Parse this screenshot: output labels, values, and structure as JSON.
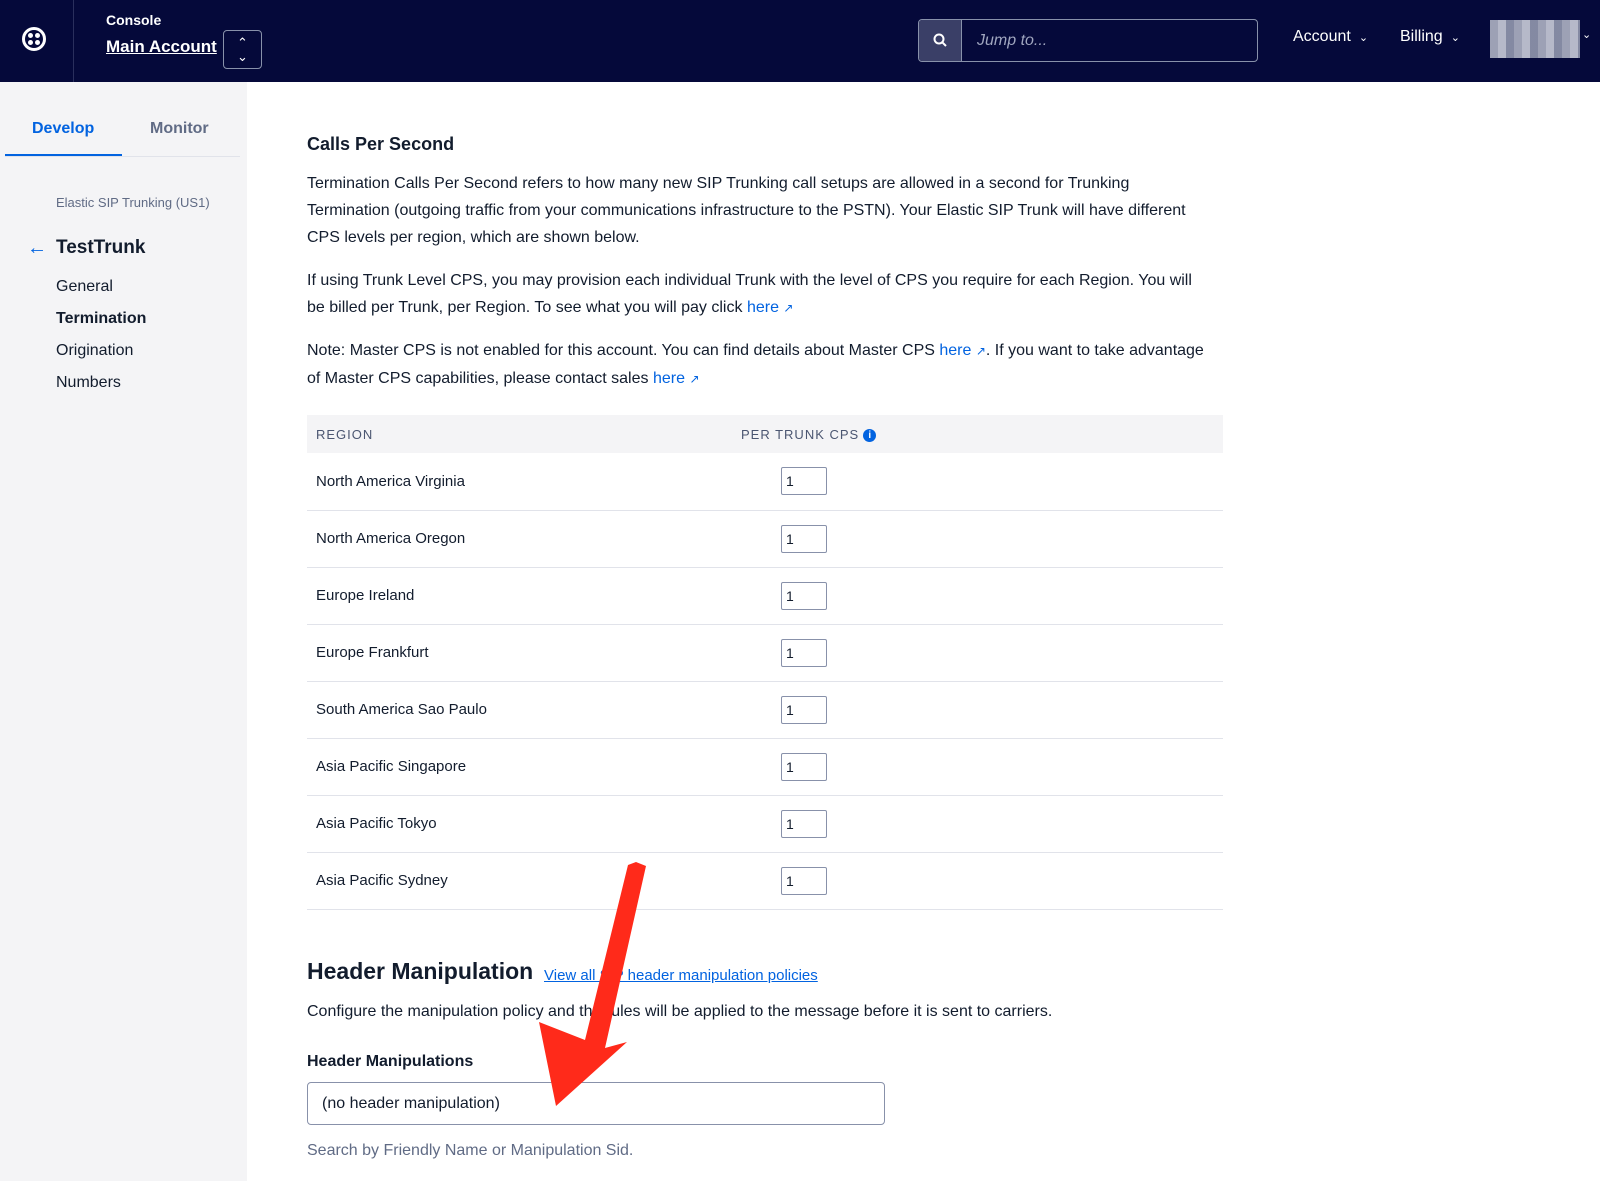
{
  "topbar": {
    "console_label": "Console",
    "account_name": "Main Account",
    "switcher_icon": "chevron-up-down-icon",
    "search_placeholder": "Jump to...",
    "menus": [
      {
        "label": "Account"
      },
      {
        "label": "Billing"
      }
    ]
  },
  "sidebar": {
    "tabs": [
      {
        "label": "Develop",
        "active": true
      },
      {
        "label": "Monitor",
        "active": false
      }
    ],
    "product": "Elastic SIP Trunking (US1)",
    "trunk_name": "TestTrunk",
    "items": [
      {
        "label": "General",
        "active": false
      },
      {
        "label": "Termination",
        "active": true
      },
      {
        "label": "Origination",
        "active": false
      },
      {
        "label": "Numbers",
        "active": false
      }
    ]
  },
  "main": {
    "cps_title": "Calls Per Second",
    "p1": "Termination Calls Per Second refers to how many new SIP Trunking call setups are allowed in a second for Trunking Termination (outgoing traffic from your communications infrastructure to the PSTN). Your Elastic SIP Trunk will have different CPS levels per region, which are shown below.",
    "p2_before": "If using Trunk Level CPS, you may provision each individual Trunk with the level of CPS you require for each Region. You will be billed per Trunk, per Region. To see what you will pay click ",
    "p3_a": "Note: Master CPS is not enabled for this account. You can find details about Master CPS ",
    "p3_b": ". If you want to take advantage of Master CPS capabilities, please contact sales ",
    "link_here": "here",
    "ext_icon": "↗",
    "table": {
      "headers": [
        "REGION",
        "PER TRUNK CPS"
      ],
      "rows": [
        {
          "region": "North America Virginia",
          "cps": "1"
        },
        {
          "region": "North America Oregon",
          "cps": "1"
        },
        {
          "region": "Europe Ireland",
          "cps": "1"
        },
        {
          "region": "Europe Frankfurt",
          "cps": "1"
        },
        {
          "region": "South America Sao Paulo",
          "cps": "1"
        },
        {
          "region": "Asia Pacific Singapore",
          "cps": "1"
        },
        {
          "region": "Asia Pacific Tokyo",
          "cps": "1"
        },
        {
          "region": "Asia Pacific Sydney",
          "cps": "1"
        }
      ]
    },
    "header_title": "Header Manipulation",
    "header_link": "View all SIP header manipulation policies",
    "p4": "Configure the manipulation policy and the rules will be applied to the message before it is sent to carriers.",
    "hm_label": "Header Manipulations",
    "hm_value": "(no header manipulation)",
    "hm_help": "Search by Friendly Name or Manipulation Sid."
  },
  "annotation": {
    "color": "#ff2a1a"
  }
}
